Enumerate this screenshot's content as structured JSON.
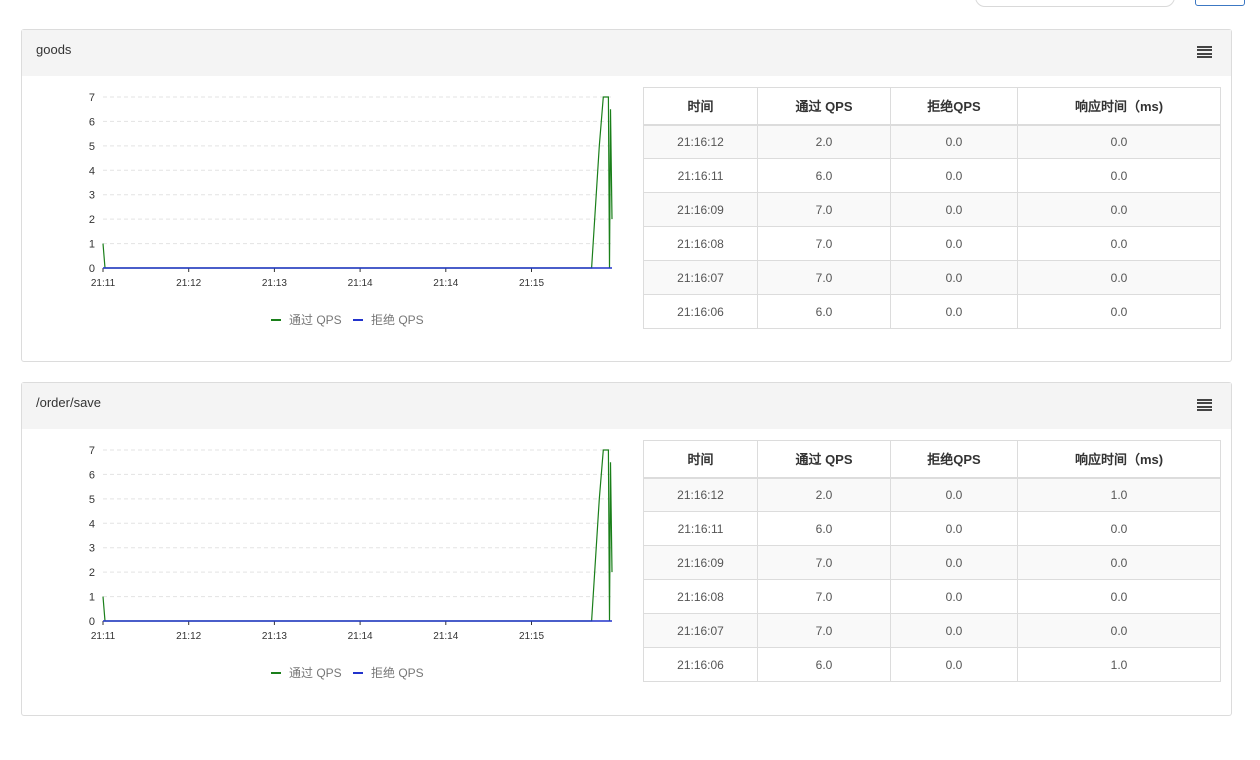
{
  "colors": {
    "pass": "#1a7f1a",
    "block": "#2233cc",
    "grid": "#e3e3e3"
  },
  "icons": {
    "menu": "hamburger-menu-icon"
  },
  "panels": [
    {
      "title": "goods",
      "table": {
        "headers": [
          "时间",
          "通过 QPS",
          "拒绝QPS",
          "响应时间（ms)"
        ],
        "rows": [
          [
            "21:16:12",
            "2.0",
            "0.0",
            "0.0"
          ],
          [
            "21:16:11",
            "6.0",
            "0.0",
            "0.0"
          ],
          [
            "21:16:09",
            "7.0",
            "0.0",
            "0.0"
          ],
          [
            "21:16:08",
            "7.0",
            "0.0",
            "0.0"
          ],
          [
            "21:16:07",
            "7.0",
            "0.0",
            "0.0"
          ],
          [
            "21:16:06",
            "6.0",
            "0.0",
            "0.0"
          ]
        ]
      }
    },
    {
      "title": "/order/save",
      "table": {
        "headers": [
          "时间",
          "通过 QPS",
          "拒绝QPS",
          "响应时间（ms)"
        ],
        "rows": [
          [
            "21:16:12",
            "2.0",
            "0.0",
            "1.0"
          ],
          [
            "21:16:11",
            "6.0",
            "0.0",
            "0.0"
          ],
          [
            "21:16:09",
            "7.0",
            "0.0",
            "0.0"
          ],
          [
            "21:16:08",
            "7.0",
            "0.0",
            "0.0"
          ],
          [
            "21:16:07",
            "7.0",
            "0.0",
            "0.0"
          ],
          [
            "21:16:06",
            "6.0",
            "0.0",
            "1.0"
          ]
        ]
      }
    }
  ],
  "chart_data": [
    {
      "type": "line",
      "title": "",
      "xlabel": "",
      "ylabel": "",
      "x_tick_labels": [
        "21:11",
        "21:12",
        "21:13",
        "21:14",
        "21:14",
        "21:15"
      ],
      "y_tick_labels": [
        "0",
        "1",
        "2",
        "3",
        "4",
        "5",
        "6",
        "7"
      ],
      "ylim": [
        0,
        7
      ],
      "grid": true,
      "legend": "bottom-center",
      "series": [
        {
          "name": "通过 QPS",
          "points": [
            [
              0,
              1
            ],
            [
              0.004,
              0
            ],
            [
              0.96,
              0
            ],
            [
              0.975,
              5
            ],
            [
              0.983,
              7
            ],
            [
              0.993,
              7
            ],
            [
              0.995,
              0
            ],
            [
              0.997,
              6.5
            ],
            [
              1,
              2
            ]
          ]
        },
        {
          "name": "拒绝 QPS",
          "points": [
            [
              0,
              0
            ],
            [
              1,
              0
            ]
          ]
        }
      ]
    },
    {
      "type": "line",
      "title": "",
      "xlabel": "",
      "ylabel": "",
      "x_tick_labels": [
        "21:11",
        "21:12",
        "21:13",
        "21:14",
        "21:14",
        "21:15"
      ],
      "y_tick_labels": [
        "0",
        "1",
        "2",
        "3",
        "4",
        "5",
        "6",
        "7"
      ],
      "ylim": [
        0,
        7
      ],
      "grid": true,
      "legend": "bottom-center",
      "series": [
        {
          "name": "通过 QPS",
          "points": [
            [
              0,
              1
            ],
            [
              0.004,
              0
            ],
            [
              0.96,
              0
            ],
            [
              0.975,
              5
            ],
            [
              0.983,
              7
            ],
            [
              0.993,
              7
            ],
            [
              0.995,
              0
            ],
            [
              0.997,
              6.5
            ],
            [
              1,
              2
            ]
          ]
        },
        {
          "name": "拒绝 QPS",
          "points": [
            [
              0,
              0
            ],
            [
              1,
              0
            ]
          ]
        }
      ]
    }
  ]
}
